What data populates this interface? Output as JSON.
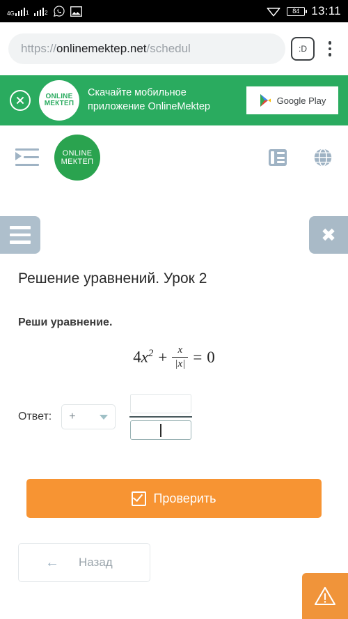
{
  "status_bar": {
    "network_type": "4G",
    "sim1_label": "1",
    "sim2_label": "2",
    "whatsapp_icon": "whatsapp-icon",
    "screenshot_icon": "image-icon",
    "wifi_icon": "wifi-icon",
    "battery_level": "84",
    "clock": "13:11"
  },
  "browser": {
    "url_prefix": "https://",
    "url_domain": "onlinemektep.net",
    "url_path": "/schedul",
    "emoji_button_label": ":D",
    "menu_icon": "kebab-menu-icon"
  },
  "app_banner": {
    "close_icon": "close-circle-icon",
    "logo_line1": "ONLINE",
    "logo_line2": "МЕКТЕП",
    "text_line1": "Скачайте мобильное",
    "text_line2": "приложение OnlineMektep",
    "store_button_label": "Google Play",
    "background_color": "#2aab5f"
  },
  "site_header": {
    "indent_icon": "indent-menu-icon",
    "logo_line1": "ONLINE",
    "logo_line2": "МЕКТЕП",
    "journal_icon": "journal-list-icon",
    "language_icon": "globe-icon"
  },
  "lesson_toolbar": {
    "menu_icon": "hamburger-icon",
    "close_label": "✖"
  },
  "lesson": {
    "title": "Решение уравнений. Урок 2",
    "task_prompt": "Реши уравнение.",
    "equation": {
      "coefficient": "4",
      "variable": "x",
      "exponent": "2",
      "operator": "+",
      "fraction_numerator": "x",
      "fraction_denominator": "|x|",
      "equals": "=",
      "right_side": "0",
      "plain": "4x² + x/|x| = 0"
    },
    "answer": {
      "label": "Ответ:",
      "sign_value": "+",
      "numerator_value": "",
      "denominator_value": ""
    },
    "check_button_label": "Проверить",
    "back_button_label": "Назад",
    "back_arrow": "←"
  },
  "report": {
    "icon": "warning-triangle-icon",
    "color": "#f0943a"
  }
}
